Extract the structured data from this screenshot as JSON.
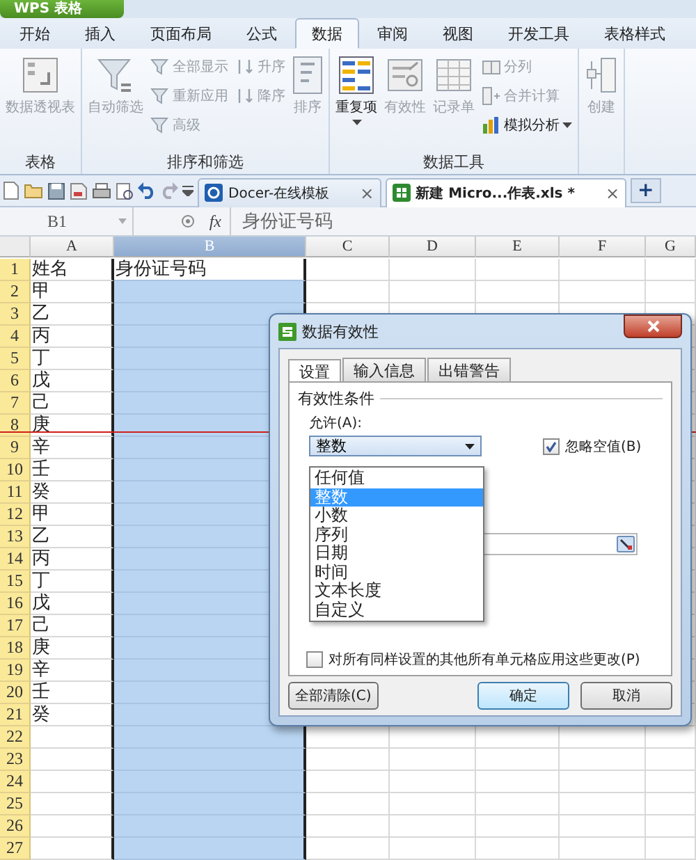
{
  "app_button": {
    "label": "WPS 表格"
  },
  "menu_tabs": [
    {
      "label": "开始",
      "selected": false
    },
    {
      "label": "插入",
      "selected": false
    },
    {
      "label": "页面布局",
      "selected": false
    },
    {
      "label": "公式",
      "selected": false
    },
    {
      "label": "数据",
      "selected": true
    },
    {
      "label": "审阅",
      "selected": false
    },
    {
      "label": "视图",
      "selected": false
    },
    {
      "label": "开发工具",
      "selected": false
    },
    {
      "label": "表格样式",
      "selected": false
    }
  ],
  "ribbon": {
    "groups": [
      {
        "label": "表格",
        "items": [
          {
            "kind": "large",
            "label": "数据透视表",
            "disabled": true,
            "dropdown": false
          }
        ]
      },
      {
        "label": "排序和筛选",
        "items": [
          {
            "kind": "large",
            "label": "自动筛选",
            "disabled": true,
            "dropdown": false
          },
          {
            "kind": "stack",
            "items": [
              {
                "label": "全部显示",
                "disabled": true,
                "dropdown": false
              },
              {
                "label": "重新应用",
                "disabled": true,
                "dropdown": false
              },
              {
                "label": "高级",
                "disabled": true,
                "dropdown": false
              }
            ]
          },
          {
            "kind": "stack",
            "items": [
              {
                "label": "升序",
                "disabled": true,
                "dropdown": false
              },
              {
                "label": "降序",
                "disabled": true,
                "dropdown": false
              }
            ]
          },
          {
            "kind": "large",
            "label": "排序",
            "disabled": true,
            "dropdown": false
          }
        ]
      },
      {
        "label": "数据工具",
        "items": [
          {
            "kind": "large",
            "label": "重复项",
            "disabled": false,
            "dropdown": true
          },
          {
            "kind": "large",
            "label": "有效性",
            "disabled": true,
            "dropdown": false
          },
          {
            "kind": "large",
            "label": "记录单",
            "disabled": true,
            "dropdown": false
          },
          {
            "kind": "stack",
            "items": [
              {
                "label": "分列",
                "disabled": true,
                "dropdown": false
              },
              {
                "label": "合并计算",
                "disabled": true,
                "dropdown": false
              },
              {
                "label": "模拟分析",
                "disabled": false,
                "dropdown": true
              }
            ]
          }
        ]
      },
      {
        "items": [
          {
            "kind": "large",
            "label": "创建",
            "disabled": true,
            "dropdown": false
          }
        ]
      }
    ]
  },
  "doc_tabs": [
    {
      "label": "Docer-在线模板",
      "close": "×",
      "selected": false
    },
    {
      "label": "新建 Micro...作表.xls *",
      "close": "×",
      "selected": true
    }
  ],
  "new_tab": "+",
  "formula_bar": {
    "cell_ref": "B1",
    "fx": "fx",
    "formula": "身份证号码"
  },
  "columns": [
    {
      "label": "A",
      "selected": false
    },
    {
      "label": "B",
      "selected": true
    },
    {
      "label": "C",
      "selected": false
    },
    {
      "label": "D",
      "selected": false
    },
    {
      "label": "E",
      "selected": false
    },
    {
      "label": "F",
      "selected": false
    },
    {
      "label": "G",
      "selected": false
    }
  ],
  "rows": [
    {
      "number": "1",
      "column_a": "姓名",
      "column_b": "身份证号码",
      "active": true
    },
    {
      "number": "2",
      "column_a": "甲",
      "active": false
    },
    {
      "number": "3",
      "column_a": "乙",
      "active": false
    },
    {
      "number": "4",
      "column_a": "丙",
      "active": false
    },
    {
      "number": "5",
      "column_a": "丁",
      "active": false
    },
    {
      "number": "6",
      "column_a": "戊",
      "active": false
    },
    {
      "number": "7",
      "column_a": "己",
      "active": false
    },
    {
      "number": "8",
      "column_a": "庚",
      "active": false
    },
    {
      "number": "9",
      "column_a": "辛",
      "active": false
    },
    {
      "number": "10",
      "column_a": "壬",
      "active": false
    },
    {
      "number": "11",
      "column_a": "癸",
      "active": false
    },
    {
      "number": "12",
      "column_a": "甲",
      "active": false
    },
    {
      "number": "13",
      "column_a": "乙",
      "active": false
    },
    {
      "number": "14",
      "column_a": "丙",
      "active": false
    },
    {
      "number": "15",
      "column_a": "丁",
      "active": false
    },
    {
      "number": "16",
      "column_a": "戊",
      "active": false
    },
    {
      "number": "17",
      "column_a": "己",
      "active": false
    },
    {
      "number": "18",
      "column_a": "庚",
      "active": false
    },
    {
      "number": "19",
      "column_a": "辛",
      "active": false
    },
    {
      "number": "20",
      "column_a": "壬",
      "active": false
    },
    {
      "number": "21",
      "column_a": "癸",
      "active": false
    },
    {
      "number": "22",
      "active": false
    },
    {
      "number": "23",
      "active": false
    },
    {
      "number": "24",
      "active": false
    },
    {
      "number": "25",
      "active": false
    },
    {
      "number": "26",
      "active": false
    },
    {
      "number": "27",
      "active": false
    }
  ],
  "dialog": {
    "title": "数据有效性",
    "tabs": [
      {
        "label": "设置",
        "selected": true
      },
      {
        "label": "输入信息",
        "selected": false
      },
      {
        "label": "出错警告",
        "selected": false
      }
    ],
    "section_title": "有效性条件",
    "allow_label": "允许(A):",
    "allow_value": "整数",
    "allow_options": [
      {
        "label": "任何值",
        "selected": false
      },
      {
        "label": "整数",
        "selected": true
      },
      {
        "label": "小数",
        "selected": false
      },
      {
        "label": "序列",
        "selected": false
      },
      {
        "label": "日期",
        "selected": false
      },
      {
        "label": "时间",
        "selected": false
      },
      {
        "label": "文本长度",
        "selected": false
      },
      {
        "label": "自定义",
        "selected": false
      }
    ],
    "ignore_blank": {
      "label": "忽略空值(B)",
      "checked": true
    },
    "apply_all": {
      "label": "对所有同样设置的其他所有单元格应用这些更改(P)",
      "checked": false
    },
    "buttons": [
      {
        "label": "全部清除(C)",
        "kind": "left"
      },
      {
        "label": "确定",
        "kind": "default"
      },
      {
        "label": "取消",
        "kind": "normal"
      }
    ]
  }
}
